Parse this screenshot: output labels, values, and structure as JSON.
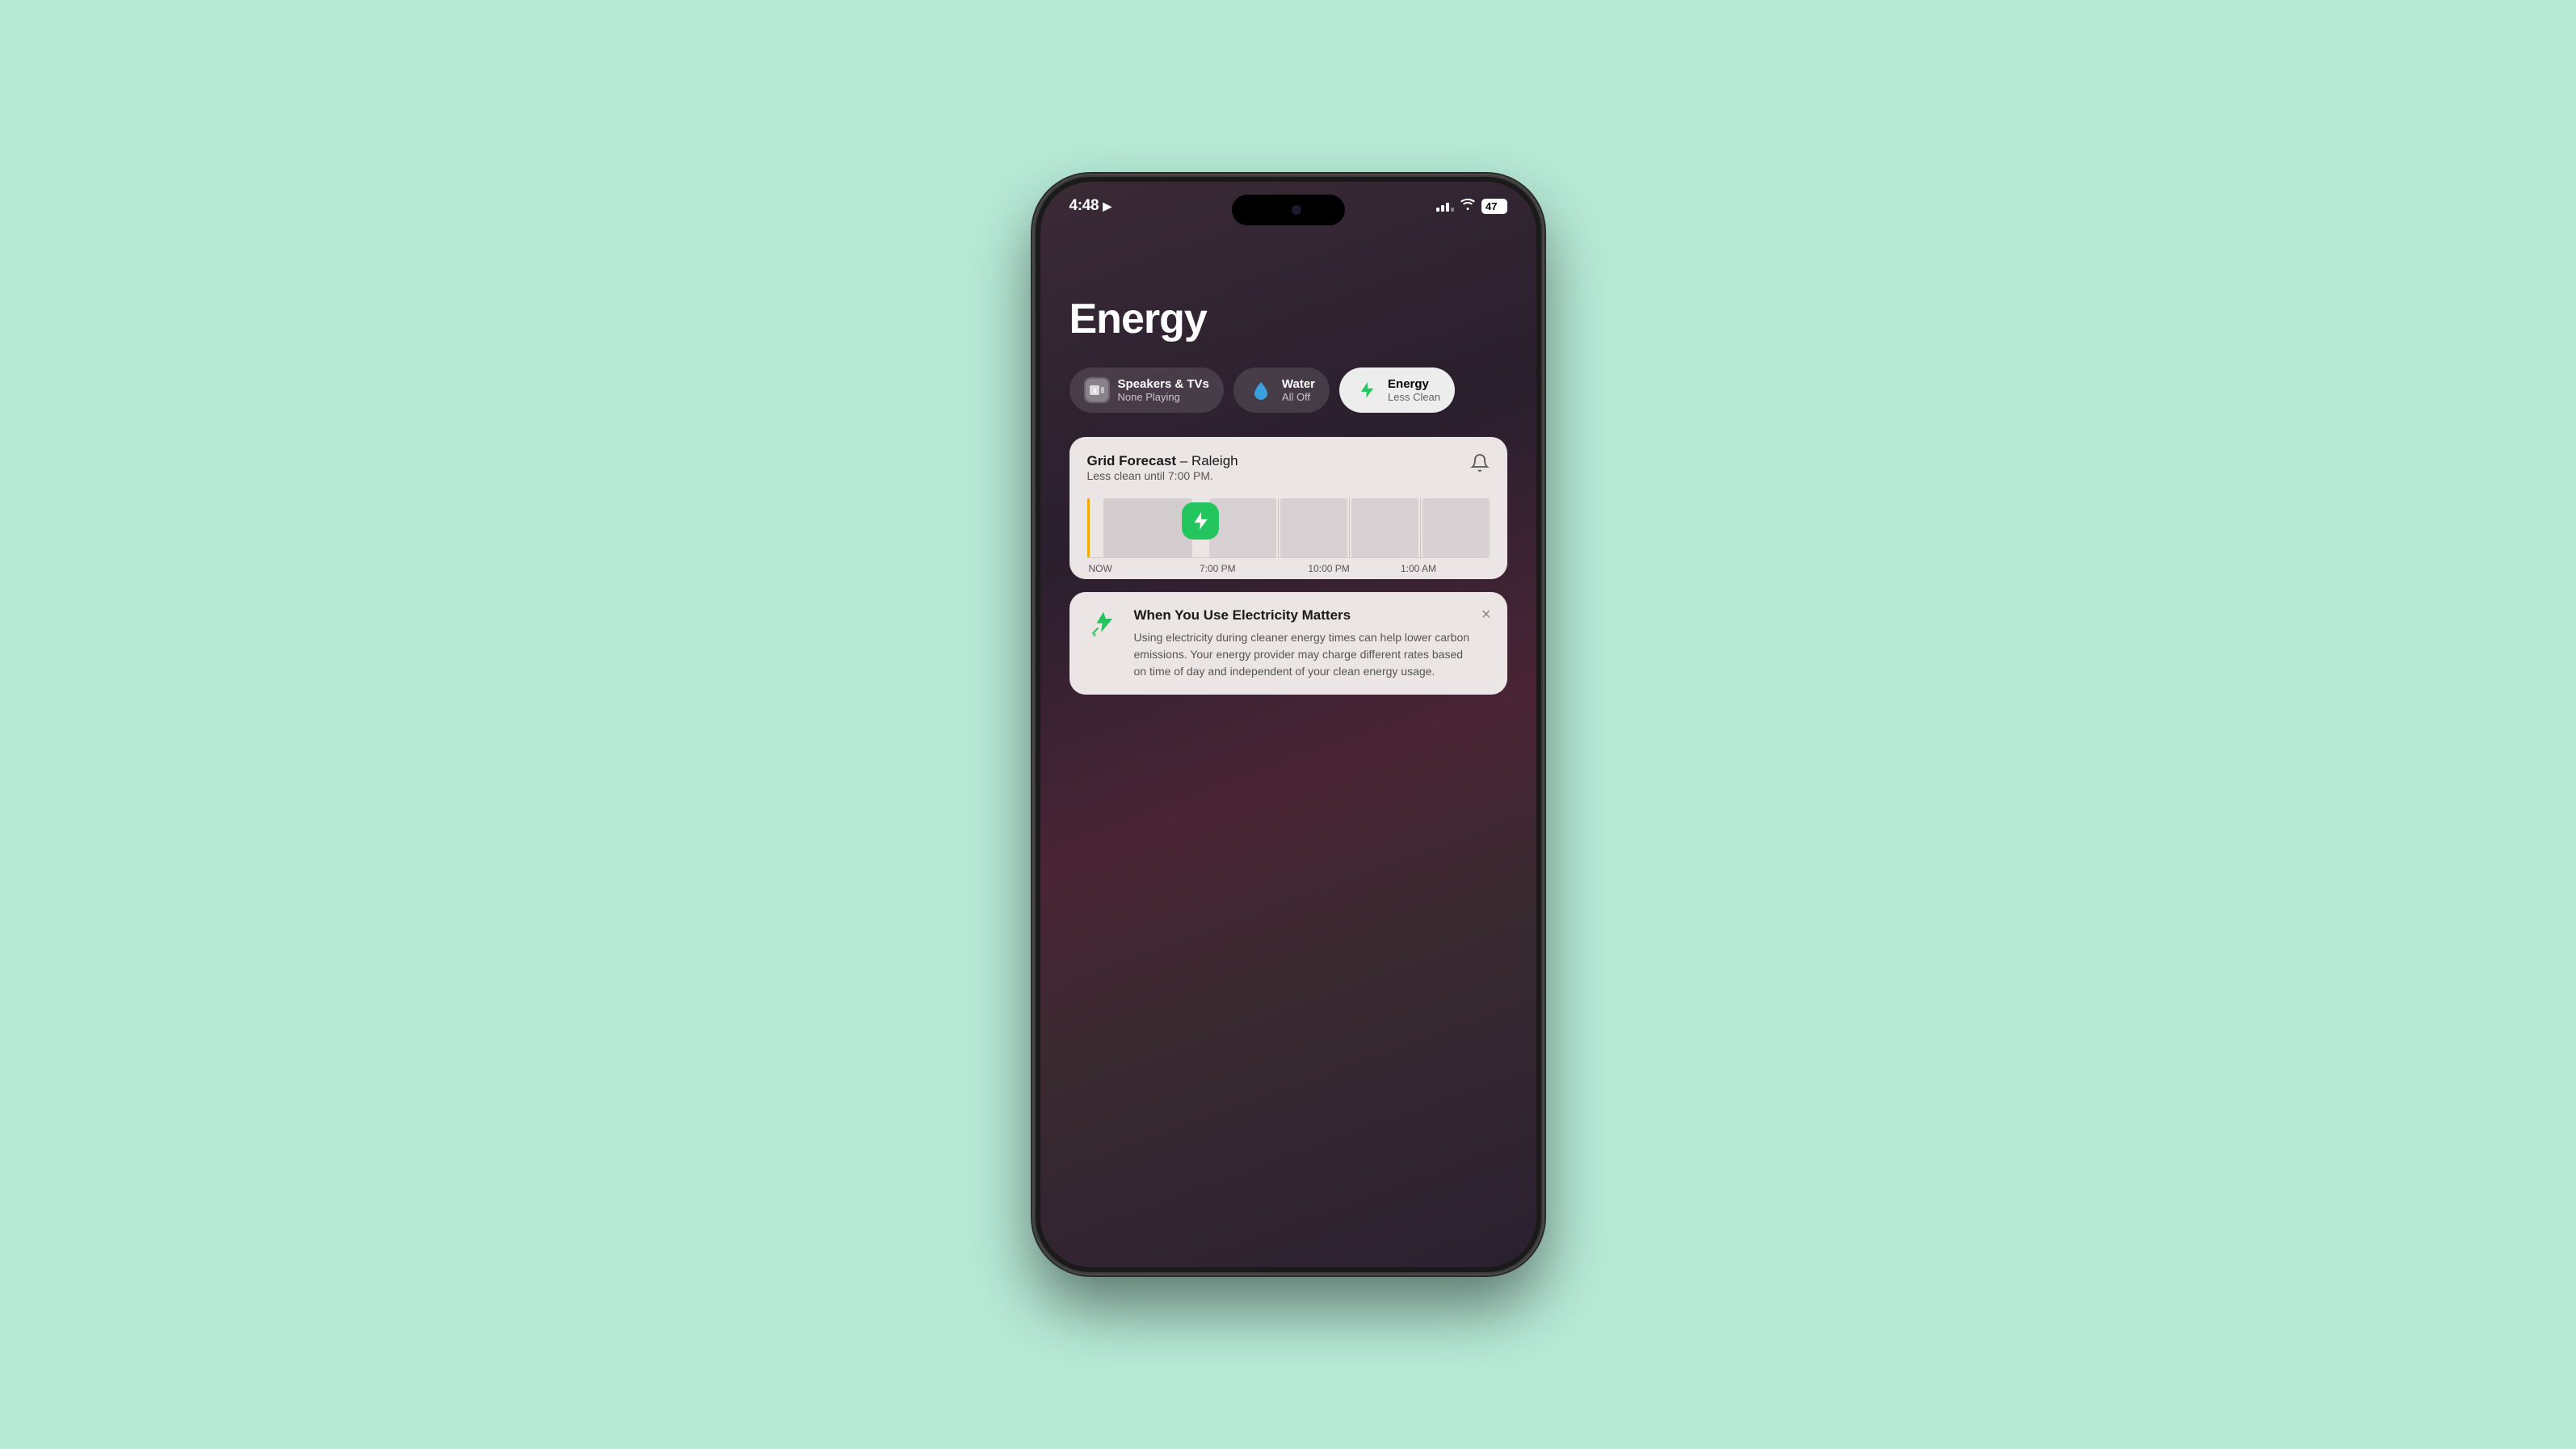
{
  "background": {
    "color": "#b8ead8"
  },
  "status_bar": {
    "time": "4:48",
    "location_icon": "▶",
    "battery_level": "47",
    "battery_unit": "%"
  },
  "page": {
    "title": "Energy"
  },
  "pills": [
    {
      "id": "speakers",
      "icon": "speakers",
      "label": "Speakers & TVs",
      "sublabel": "None Playing",
      "active": false
    },
    {
      "id": "water",
      "icon": "water",
      "label": "Water",
      "sublabel": "All Off",
      "active": false
    },
    {
      "id": "energy",
      "icon": "energy",
      "label": "Energy",
      "sublabel": "Less Clean",
      "active": true
    }
  ],
  "forecast_card": {
    "title_bold": "Grid Forecast",
    "title_rest": " – Raleigh",
    "subtitle": "Less clean until 7:00 PM.",
    "chart_labels": [
      "NOW",
      "7:00 PM",
      "10:00 PM",
      "1:00 AM"
    ],
    "bell_label": "notification bell"
  },
  "info_card": {
    "title": "When You Use Electricity Matters",
    "body": "Using electricity during cleaner energy times can help lower carbon emissions. Your energy provider may charge different rates based on time of day and independent of your clean energy usage.",
    "close_label": "×"
  }
}
